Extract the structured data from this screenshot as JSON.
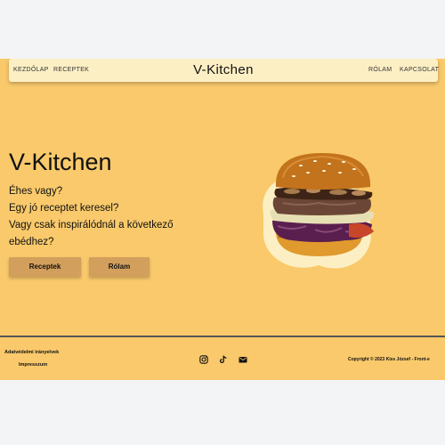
{
  "nav": {
    "links_left": [
      "KEZDŐLAP",
      "RECEPTEK"
    ],
    "brand": "V-Kitchen",
    "links_right": [
      "RÓLAM",
      "KAPCSOLAT"
    ]
  },
  "hero": {
    "title": "V-Kitchen",
    "lines": [
      "Éhes vagy?",
      "Egy jó receptet keresel?",
      "Vagy csak inspirálódnál a következő",
      "ebédhez?"
    ],
    "buttons": [
      "Receptek",
      "Rólam"
    ]
  },
  "footer": {
    "privacy": "Adatvédelmi irányelvek",
    "imprint": "Impresszum",
    "copyright": "Copyright © 2023 Kiss József - Front-e",
    "social_icons": [
      "instagram-icon",
      "tiktok-icon",
      "mail-icon"
    ]
  },
  "colors": {
    "background": "#f9c96b",
    "nav": "#fdefc4",
    "button": "#d29f5c"
  }
}
